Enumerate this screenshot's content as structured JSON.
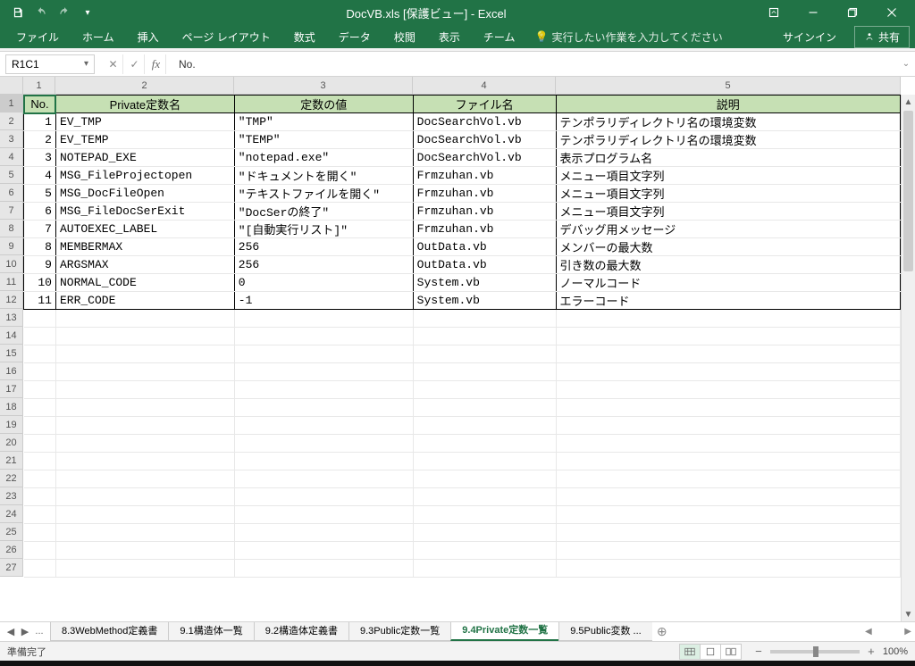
{
  "title": "DocVB.xls  [保護ビュー] - Excel",
  "qat_icons": [
    "save",
    "undo",
    "redo",
    "customize"
  ],
  "window_buttons": [
    "ribbon-display",
    "minimize",
    "restore",
    "close"
  ],
  "ribbon": {
    "tabs": [
      "ファイル",
      "ホーム",
      "挿入",
      "ページ レイアウト",
      "数式",
      "データ",
      "校閲",
      "表示",
      "チーム"
    ],
    "tell_me": "実行したい作業を入力してください",
    "signin": "サインイン",
    "share": "共有"
  },
  "formula_bar": {
    "name_box": "R1C1",
    "formula": "No."
  },
  "columns": [
    "1",
    "2",
    "3",
    "4",
    "5"
  ],
  "row_headers": [
    1,
    2,
    3,
    4,
    5,
    6,
    7,
    8,
    9,
    10,
    11,
    12,
    13,
    14,
    15,
    16,
    17,
    18,
    19,
    20,
    21,
    22,
    23,
    24,
    25,
    26,
    27
  ],
  "table": {
    "headers": [
      "No.",
      "Private定数名",
      "定数の値",
      "ファイル名",
      "説明"
    ],
    "rows": [
      {
        "no": 1,
        "name": "EV_TMP",
        "val": "\"TMP\"",
        "file": "DocSearchVol.vb",
        "desc": "テンポラリディレクトリ名の環境変数"
      },
      {
        "no": 2,
        "name": "EV_TEMP",
        "val": "\"TEMP\"",
        "file": "DocSearchVol.vb",
        "desc": "テンポラリディレクトリ名の環境変数"
      },
      {
        "no": 3,
        "name": "NOTEPAD_EXE",
        "val": "\"notepad.exe\"",
        "file": "DocSearchVol.vb",
        "desc": "表示プログラム名"
      },
      {
        "no": 4,
        "name": "MSG_FileProjectopen",
        "val": "\"ドキュメントを開く\"",
        "file": "Frmzuhan.vb",
        "desc": "メニュー項目文字列"
      },
      {
        "no": 5,
        "name": "MSG_DocFileOpen",
        "val": "\"テキストファイルを開く\"",
        "file": "Frmzuhan.vb",
        "desc": "メニュー項目文字列"
      },
      {
        "no": 6,
        "name": "MSG_FileDocSerExit",
        "val": "\"DocSerの終了\"",
        "file": "Frmzuhan.vb",
        "desc": "メニュー項目文字列"
      },
      {
        "no": 7,
        "name": "AUTOEXEC_LABEL",
        "val": "\"[自動実行リスト]\"",
        "file": "Frmzuhan.vb",
        "desc": "デバッグ用メッセージ"
      },
      {
        "no": 8,
        "name": "MEMBERMAX",
        "val": "256",
        "file": "OutData.vb",
        "desc": "メンバーの最大数"
      },
      {
        "no": 9,
        "name": "ARGSMAX",
        "val": "256",
        "file": "OutData.vb",
        "desc": "引き数の最大数"
      },
      {
        "no": 10,
        "name": "NORMAL_CODE",
        "val": "0",
        "file": "System.vb",
        "desc": "ノーマルコード"
      },
      {
        "no": 11,
        "name": "ERR_CODE",
        "val": "-1",
        "file": "System.vb",
        "desc": "エラーコード"
      }
    ]
  },
  "sheet_tabs": {
    "ellipsis": "...",
    "tabs": [
      "8.3WebMethod定義書",
      "9.1構造体一覧",
      "9.2構造体定義書",
      "9.3Public定数一覧",
      "9.4Private定数一覧",
      "9.5Public変数 ..."
    ],
    "active_index": 4
  },
  "statusbar": {
    "status": "準備完了",
    "zoom": "100%"
  }
}
